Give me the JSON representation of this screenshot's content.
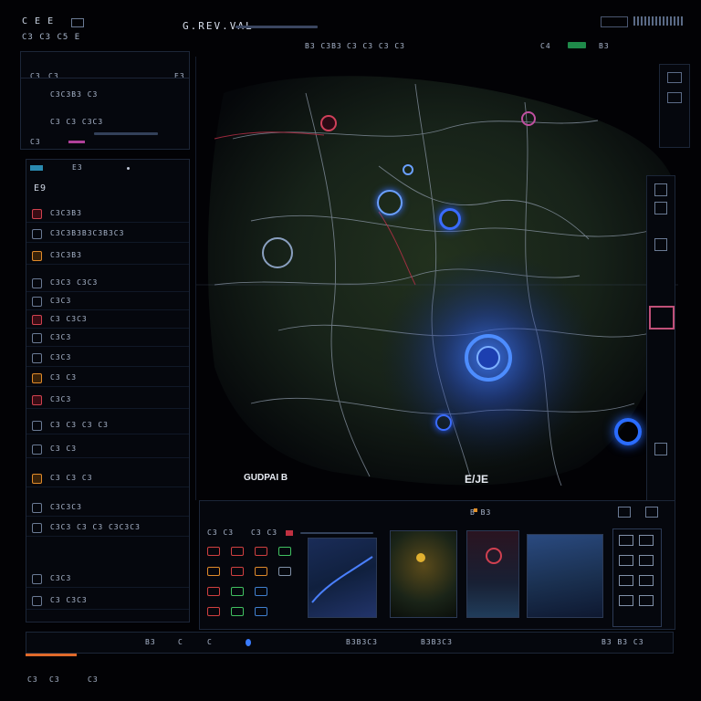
{
  "app": {
    "title": "G.REV.VAL",
    "top_left": "C E E",
    "menu": "C3 C3 C5 E",
    "tabs": [
      "B3 C3B3",
      "C3 C3 C3 C3",
      "C4"
    ],
    "top_right": "B3"
  },
  "left_top_panel": {
    "header": [
      "C3",
      "C3",
      "E3"
    ],
    "rows": [
      "C3C3B3 C3",
      "C3 C3 C3C3",
      "C3"
    ]
  },
  "left_panel": {
    "header": "E3",
    "item_label": "E9",
    "rows": [
      "C3C3B3",
      "C3C3B3B3C3B3C3",
      "C3C3B3",
      "C3C3 C3C3",
      "C3C3",
      "C3 C3C3",
      "C3C3",
      "C3C3",
      "C3 C3",
      "C3C3",
      "C3 C3 C3 C3",
      "C3 C3",
      "C3 C3 C3",
      "C3C3C3",
      "C3C3 C3 C3 C3C3C3",
      "C3C3",
      "C3 C3C3"
    ]
  },
  "map": {
    "label_1": "GUDPAI B",
    "label_2": "E/JE"
  },
  "bottom_panel": {
    "title": "B B3",
    "tabs": [
      "C3 C3",
      "C3 C3"
    ]
  },
  "status_bar": {
    "items": [
      "B3",
      "C",
      "C",
      "B3B3C3",
      "B3B3C3",
      "B3 B3 C3"
    ]
  },
  "footer": {
    "icons": [
      "C3",
      "C3",
      "C3"
    ]
  }
}
